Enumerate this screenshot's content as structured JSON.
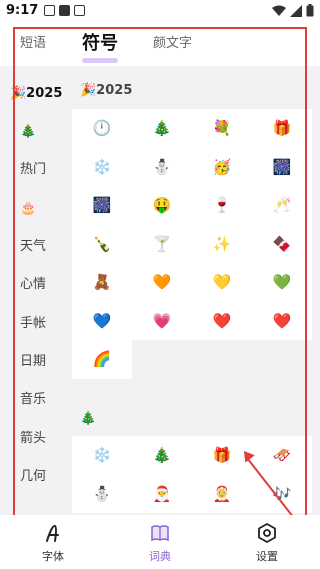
{
  "status_bar": {
    "time": "9:17"
  },
  "tabs": [
    {
      "label": "短语",
      "active": false
    },
    {
      "label": "符号",
      "active": true
    },
    {
      "label": "颜文字",
      "active": false
    }
  ],
  "sidebar": {
    "items": [
      {
        "label": "🎉2025",
        "active": true
      },
      {
        "label": "🎄",
        "active": false
      },
      {
        "label": "热门",
        "active": false
      },
      {
        "label": "🎂",
        "active": false
      },
      {
        "label": "天气",
        "active": false
      },
      {
        "label": "心情",
        "active": false
      },
      {
        "label": "手帐",
        "active": false
      },
      {
        "label": "日期",
        "active": false
      },
      {
        "label": "音乐",
        "active": false
      },
      {
        "label": "箭头",
        "active": false
      },
      {
        "label": "几何",
        "active": false
      }
    ]
  },
  "sections": [
    {
      "title": "🎉2025",
      "symbols": [
        "🕛",
        "🎄",
        "💐",
        "🎁",
        "❄️",
        "⛄",
        "🥳",
        "🎆",
        "🎆",
        "🤑",
        "🍷",
        "🥂",
        "🍾",
        "🍸",
        "✨",
        "🍫",
        "🧸",
        "🧡",
        "💛",
        "💚",
        "💙",
        "💗",
        "❤️",
        "❤️",
        "🌈"
      ]
    },
    {
      "title": "🎄",
      "symbols": [
        "❄️",
        "🎄",
        "🎁",
        "🛷",
        "⛄",
        "🎅",
        "🤶",
        "🎶"
      ]
    }
  ],
  "bottom_nav": [
    {
      "label": "字体",
      "icon": "font-icon",
      "active": false
    },
    {
      "label": "词典",
      "icon": "book-icon",
      "active": true
    },
    {
      "label": "设置",
      "icon": "settings-icon",
      "active": false
    }
  ],
  "colors": {
    "accent": "#8a63d2",
    "annotation": "#e23b3b",
    "content_bg": "#f2f2f4"
  }
}
